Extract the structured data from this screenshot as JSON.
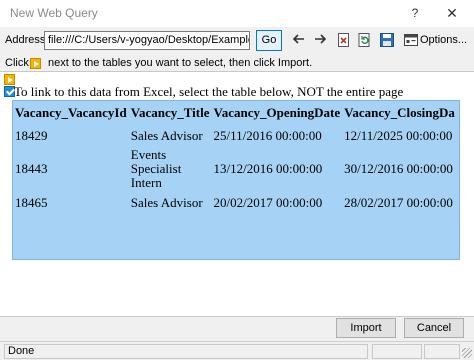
{
  "window": {
    "title": "New Web Query",
    "help_glyph": "?",
    "close_glyph": "✕"
  },
  "toolbar": {
    "address_label": "Address:",
    "address_value": "file:///C:/Users/v-yogyao/Desktop/Example.ht",
    "go_label": "Go",
    "back_icon": "arrow-left-icon",
    "forward_icon": "arrow-right-icon",
    "stop_icon": "stop-icon",
    "refresh_icon": "refresh-icon",
    "save_icon": "save-icon",
    "options_icon": "options-icon",
    "options_label": "Options..."
  },
  "instructions": {
    "click": "Click",
    "text": "next to the tables you want to select, then click Import."
  },
  "page": {
    "note": "To link to this data from Excel, select the table below, NOT the entire page",
    "table": {
      "headers": [
        "Vacancy_VacancyId",
        "Vacancy_Title",
        "Vacancy_OpeningDate",
        "Vacancy_ClosingDa"
      ],
      "rows": [
        [
          "18429",
          "Sales Advisor",
          "25/11/2016 00:00:00",
          "12/11/2025 00:00:00"
        ],
        [
          "18443",
          "Events Specialist Intern",
          "13/12/2016 00:00:00",
          "30/12/2016 00:00:00"
        ],
        [
          "18465",
          "Sales Advisor",
          "20/02/2017 00:00:00",
          "28/02/2017 00:00:00"
        ]
      ]
    }
  },
  "buttons": {
    "import": "Import",
    "cancel": "Cancel"
  },
  "status": {
    "text": "Done"
  },
  "colors": {
    "table_highlight": "#a6d3f5",
    "arrow_badge": "#f5b400",
    "check_badge": "#1f8fd1",
    "go_border": "#0078d7"
  }
}
